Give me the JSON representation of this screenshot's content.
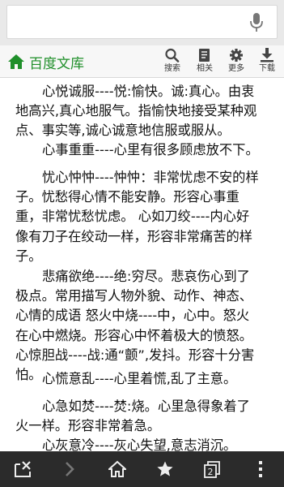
{
  "search": {
    "value": "",
    "placeholder": ""
  },
  "header": {
    "logo_text": "百度文库",
    "actions": [
      {
        "label": "搜索",
        "icon": "search-icon"
      },
      {
        "label": "相关",
        "icon": "related-icon"
      },
      {
        "label": "更多",
        "icon": "gear-icon"
      },
      {
        "label": "下载",
        "icon": "download-icon"
      }
    ]
  },
  "article": {
    "paragraphs": [
      {
        "lines": [
          "心悦诚服----悦:愉快。诚:真心。由衷",
          "地高兴,真心地服气。指愉快地接受某种观",
          "点、事实等,诚心诚意地信服或服从。"
        ]
      },
      {
        "lines": [
          "心事重重----心里有很多顾虑放不下。"
        ]
      },
      {
        "lines": [
          "忧心忡忡----忡忡：非常忧虑不安的样",
          "子。忧愁得心情不能安静。形容心事重",
          "重，非常忧愁忧虑。    心如刀绞----内心好",
          "像有刀子在绞动一样，形容非常痛苦的样",
          "子。"
        ]
      },
      {
        "lines": [
          "悲痛欲绝----绝:穷尽。悲哀伤心到了",
          "极点。常用描写人物外貌、动作、神态、",
          "心情的成语    怒火中烧----中，心中。怒火",
          "在心中燃烧。形容心中怀着极大的愤怒。",
          "心惊胆战----战:通“颤”,发抖。形容十分害",
          "怕。"
        ]
      },
      {
        "lines": [
          "心慌意乱----心里着慌,乱了主意。"
        ]
      },
      {
        "lines": [
          "心急如焚----焚:烧。心里急得象着了",
          "火一样。形容非常着急。"
        ]
      },
      {
        "lines": [
          "心灰意冷----灰心失望,意志消沉。"
        ]
      }
    ]
  },
  "bottom_bar": {
    "tab_count": "2",
    "icons": [
      "close-window-icon",
      "forward-icon",
      "home-icon",
      "star-icon",
      "tabs-icon",
      "menu-icon"
    ]
  },
  "colors": {
    "brand_green": "#1f8f2a",
    "bottom_bar": "#2b2b2b",
    "header_bg": "#f7f7f7"
  }
}
